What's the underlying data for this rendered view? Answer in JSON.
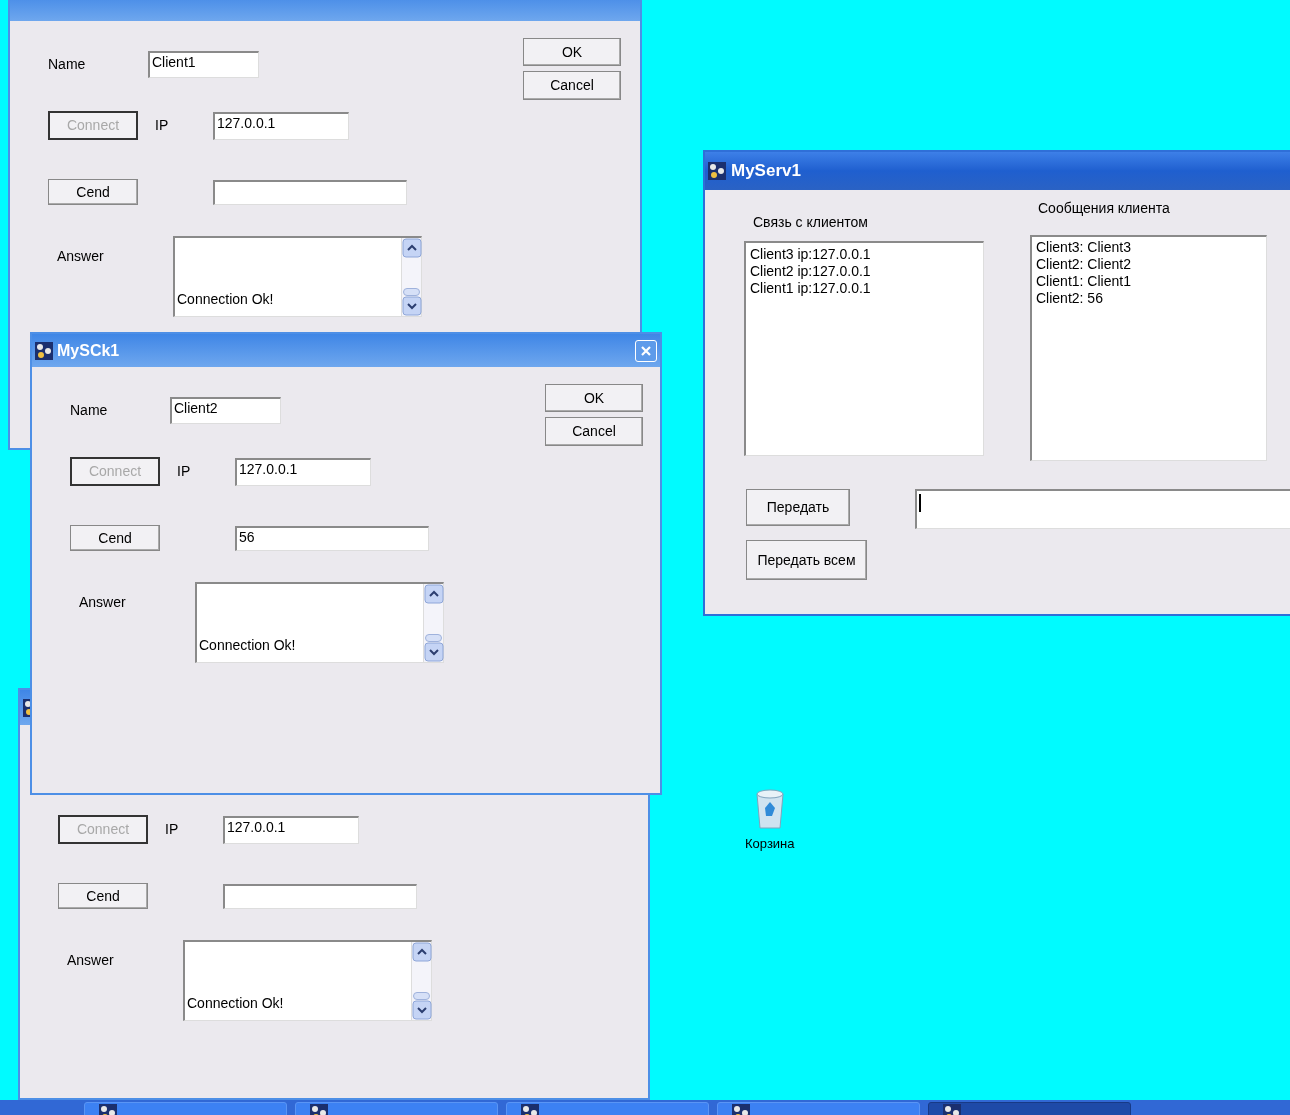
{
  "client_windows": [
    {
      "name": {
        "label": "Name",
        "value": "Client1"
      },
      "ok_button": "OK",
      "cancel_button": "Cancel",
      "connect_button": {
        "label": "Connect",
        "disabled": true
      },
      "ip": {
        "label": "IP",
        "value": "127.0.0.1"
      },
      "send_button": {
        "label": "Cend",
        "disabled": false
      },
      "answer": {
        "label": "Answer",
        "text": "Connection Ok!"
      }
    },
    {
      "title": "MySCk1",
      "name": {
        "label": "Name",
        "value": "Client2"
      },
      "ok_button": "OK",
      "cancel_button": "Cancel",
      "connect_button": {
        "label": "Connect",
        "disabled": true
      },
      "ip": {
        "label": "IP",
        "value": "127.0.0.1"
      },
      "send_button": {
        "label": "Cend",
        "disabled": false
      },
      "message": "56",
      "answer": {
        "label": "Answer",
        "text": "Connection Ok!"
      }
    },
    {
      "connect_button": {
        "label": "Connect",
        "disabled": true
      },
      "ip": {
        "label": "IP",
        "value": "127.0.0.1"
      },
      "send_button": {
        "label": "Cend",
        "disabled": false
      },
      "answer": {
        "label": "Answer",
        "text": "Connection Ok!"
      }
    }
  ],
  "server_window": {
    "title": "MyServ1",
    "clients_label": "Связь с клиентом",
    "clients": [
      "Client3 ip:127.0.0.1",
      "Client2 ip:127.0.0.1",
      "Client1 ip:127.0.0.1"
    ],
    "messages_label": "Сообщения клиента",
    "messages": [
      "Client3: Client3",
      "Client2: Client2",
      "Client1: Client1",
      "Client2: 56"
    ],
    "send_button": "Передать",
    "send_all_button": "Передать всем"
  },
  "desktop_icon": {
    "label": "Корзина"
  },
  "taskbar": {
    "buttons": [
      {
        "selected": false
      },
      {
        "selected": false
      },
      {
        "selected": false
      },
      {
        "selected": false
      },
      {
        "selected": true
      }
    ]
  }
}
